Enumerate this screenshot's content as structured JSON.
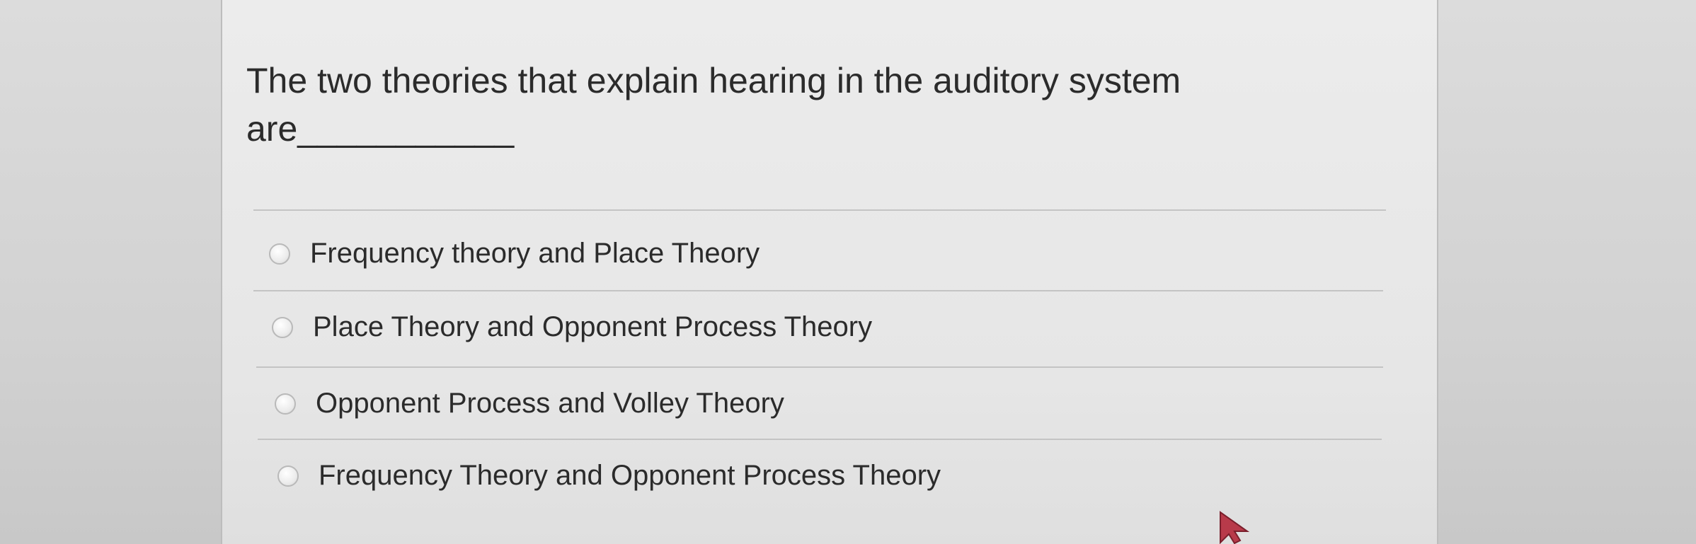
{
  "question": {
    "text": "The two theories that explain hearing in the auditory system are___________"
  },
  "answers": [
    {
      "label": "Frequency theory and Place Theory"
    },
    {
      "label": "Place Theory and Opponent Process Theory"
    },
    {
      "label": "Opponent Process and Volley Theory"
    },
    {
      "label": "Frequency Theory and Opponent Process Theory"
    }
  ],
  "colors": {
    "background": "#d6d6d6",
    "panel": "#e9e9e9",
    "text": "#2b2b2b",
    "divider": "#c4c4c4",
    "cursor": "#b83a4a"
  }
}
